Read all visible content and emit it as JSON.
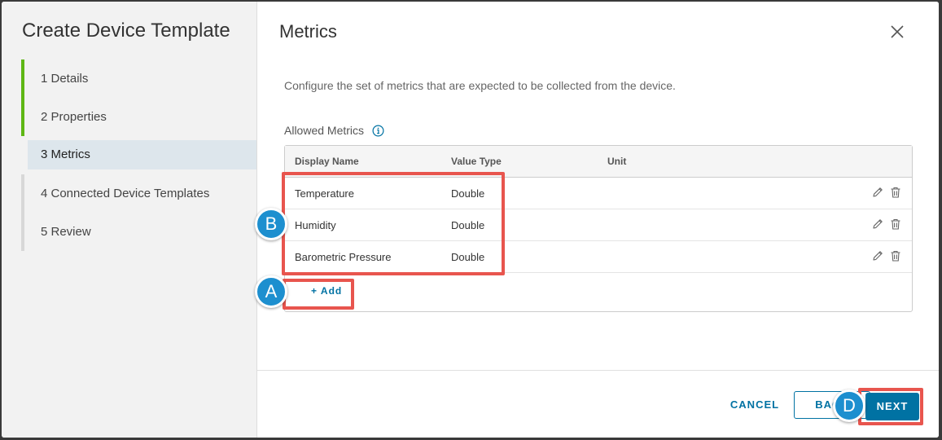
{
  "wizard": {
    "title": "Create Device Template",
    "steps": [
      {
        "label": "1 Details",
        "state": "done"
      },
      {
        "label": "2 Properties",
        "state": "done"
      },
      {
        "label": "3 Metrics",
        "state": "active"
      },
      {
        "label": "4 Connected Device Templates",
        "state": "pending"
      },
      {
        "label": "5 Review",
        "state": "pending"
      }
    ]
  },
  "page": {
    "title": "Metrics",
    "description": "Configure the set of metrics that are expected to be collected from the device.",
    "section_label": "Allowed Metrics"
  },
  "grid": {
    "columns": [
      "Display Name",
      "Value Type",
      "Unit"
    ],
    "rows": [
      {
        "name": "Temperature",
        "type": "Double",
        "unit": ""
      },
      {
        "name": "Humidity",
        "type": "Double",
        "unit": ""
      },
      {
        "name": "Barometric Pressure",
        "type": "Double",
        "unit": ""
      }
    ],
    "add_label": "+ Add"
  },
  "footer": {
    "cancel_label": "CANCEL",
    "back_label": "BACK",
    "next_label": "NEXT"
  },
  "annotations": {
    "a": "A",
    "b": "B",
    "d": "D"
  },
  "colors": {
    "accent": "#0072a3",
    "done": "#5eb715",
    "highlight": "#e8554e",
    "callout": "#1d8fcf"
  }
}
